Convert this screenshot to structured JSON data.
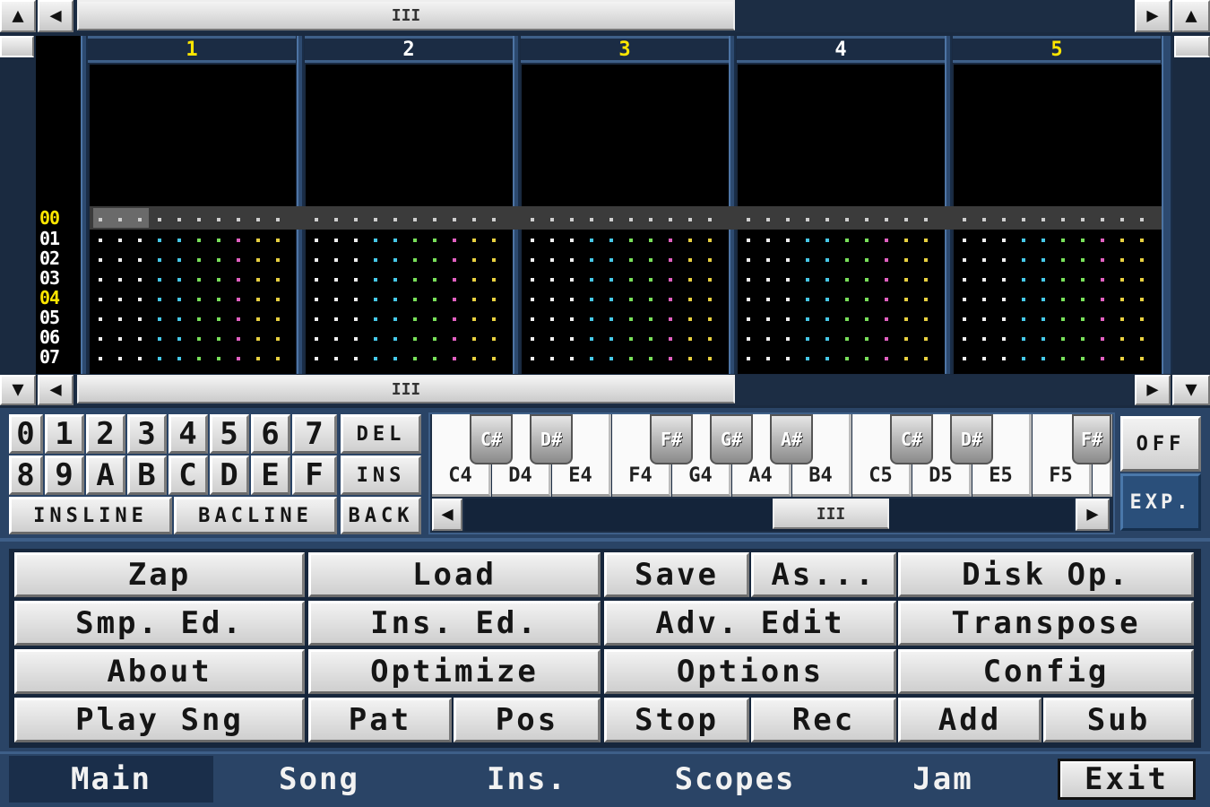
{
  "tracker": {
    "channels": [
      "1",
      "2",
      "3",
      "4",
      "5"
    ],
    "row_numbers": [
      "00",
      "01",
      "02",
      "03",
      "04",
      "05",
      "06",
      "07"
    ],
    "top_scroll_grip": "III",
    "bottom_scroll_grip": "III"
  },
  "keypad": {
    "row1": [
      "0",
      "1",
      "2",
      "3",
      "4",
      "5",
      "6",
      "7"
    ],
    "row2": [
      "8",
      "9",
      "A",
      "B",
      "C",
      "D",
      "E",
      "F"
    ],
    "del": "DEL",
    "ins": "INS",
    "insline": "INSLINE",
    "bacline": "BACLINE",
    "back": "BACK"
  },
  "piano": {
    "white_keys": [
      "C4",
      "D4",
      "E4",
      "F4",
      "G4",
      "A4",
      "B4",
      "C5",
      "D5",
      "E5",
      "F5"
    ],
    "black_keys": [
      "C#",
      "D#",
      "F#",
      "G#",
      "A#",
      "C#",
      "D#",
      "F#"
    ],
    "scroll_grip": "III",
    "off": "OFF",
    "exp": "EXP."
  },
  "buttons": {
    "zap": "Zap",
    "load": "Load",
    "save": "Save",
    "as": "As...",
    "disk_op": "Disk Op.",
    "smp_ed": "Smp. Ed.",
    "ins_ed": "Ins. Ed.",
    "adv_edit": "Adv. Edit",
    "transpose": "Transpose",
    "about": "About",
    "optimize": "Optimize",
    "options": "Options",
    "config": "Config",
    "play_sng": "Play Sng",
    "pat": "Pat",
    "pos": "Pos",
    "stop": "Stop",
    "rec": "Rec",
    "add": "Add",
    "sub": "Sub"
  },
  "tabs": {
    "main": "Main",
    "song": "Song",
    "ins": "Ins.",
    "scopes": "Scopes",
    "jam": "Jam",
    "exit": "Exit"
  },
  "colors": {
    "channel_odd_number": "#ffe600",
    "channel_even_number": "#ffffff",
    "dot_white": "#f0f0f0",
    "dot_cyan": "#46c8e8",
    "dot_green": "#78e05a",
    "dot_pink": "#e060c0",
    "dot_yellow": "#e8d040"
  },
  "icons": {
    "up": "triangle-up-icon",
    "down": "triangle-down-icon",
    "left": "triangle-left-icon",
    "right": "triangle-right-icon"
  }
}
